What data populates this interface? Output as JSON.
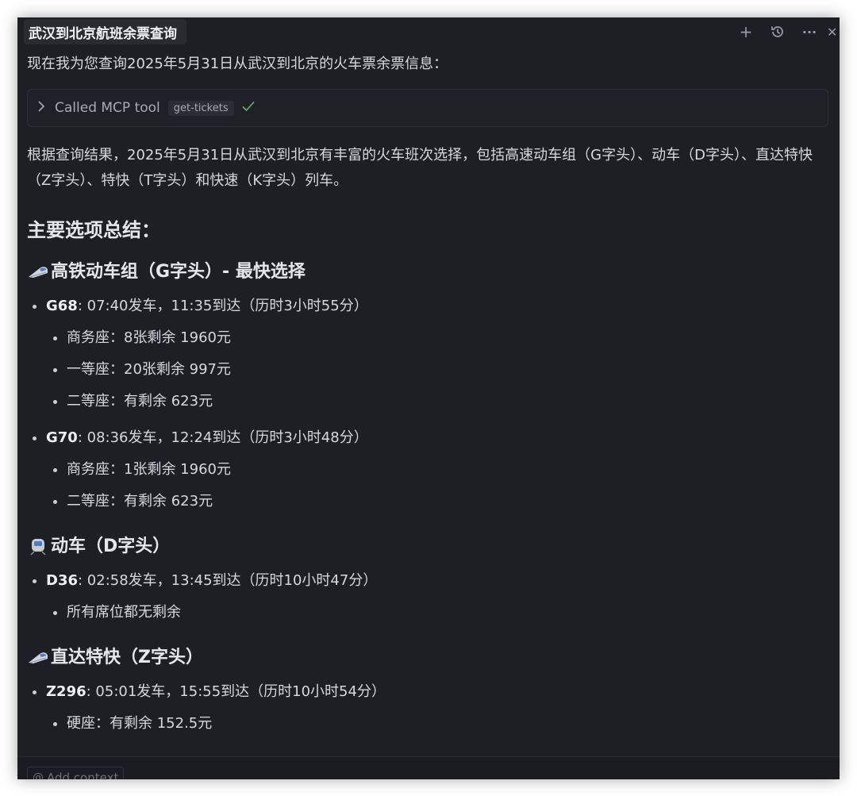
{
  "tab": {
    "title": "武汉到北京航班余票查询"
  },
  "controls": {
    "add": "+",
    "more": "···",
    "close": "✕"
  },
  "intro": "现在我为您查询2025年5月31日从武汉到北京的火车票余票信息：",
  "tool_call": {
    "label": "Called MCP tool",
    "tool": "get-tickets",
    "status_icon": "check-icon"
  },
  "summary_paragraph": "根据查询结果，2025年5月31日从武汉到北京有丰富的火车班次选择，包括高速动车组（G字头）、动车（D字头）、直达特快（Z字头）、特快（T字头）和快速（K字头）列车。",
  "section_title": "主要选项总结：",
  "groups": [
    {
      "title": "高铁动车组（G字头）- 最快选择",
      "icon": "high-speed-train-icon",
      "trains": [
        {
          "code": "G68",
          "detail": ": 07:40发车，11:35到达（历时3小时55分）",
          "seats": [
            "商务座：8张剩余 1960元",
            "一等座：20张剩余 997元",
            "二等座：有剩余 623元"
          ]
        },
        {
          "code": "G70",
          "detail": ": 08:36发车，12:24到达（历时3小时48分）",
          "seats": [
            "商务座：1张剩余 1960元",
            "二等座：有剩余 623元"
          ]
        }
      ]
    },
    {
      "title": "动车（D字头）",
      "icon": "train-front-icon",
      "trains": [
        {
          "code": "D36",
          "detail": ": 02:58发车，13:45到达（历时10小时47分）",
          "seats": [
            "所有席位都无剩余"
          ]
        }
      ]
    },
    {
      "title": "直达特快（Z字头）",
      "icon": "high-speed-train-icon",
      "trains": [
        {
          "code": "Z296",
          "detail": ": 05:01发车，15:55到达（历时10小时54分）",
          "seats": [
            "硬座：有剩余 152.5元"
          ]
        }
      ]
    }
  ],
  "footer": {
    "add_context": "Add context"
  },
  "colors": {
    "background": "#1e1f25",
    "text": "#d7d8dd",
    "heading": "#e6e7ec",
    "check": "#5fb96f"
  }
}
